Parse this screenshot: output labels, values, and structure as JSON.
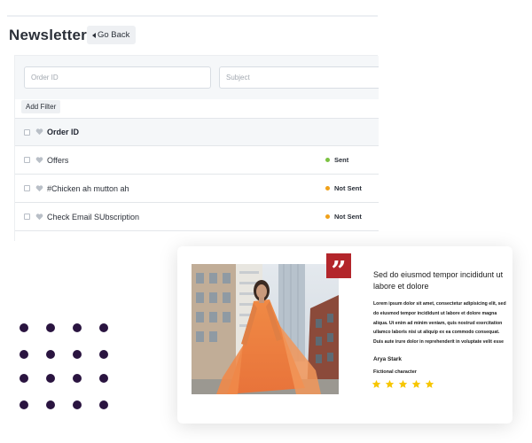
{
  "header": {
    "title": "Newsletter",
    "back_label": "Go Back"
  },
  "filters": {
    "order_id_placeholder": "Order ID",
    "subject_placeholder": "Subject",
    "add_filter_label": "Add Filter"
  },
  "table": {
    "column_header": "Order ID",
    "rows": [
      {
        "title": "Offers",
        "status": "Sent",
        "status_color": "#7cc242"
      },
      {
        "title": "#Chicken ah mutton ah",
        "status": "Not Sent",
        "status_color": "#f0a11a"
      },
      {
        "title": "Check Email SUbscription",
        "status": "Not Sent",
        "status_color": "#f0a11a"
      }
    ]
  },
  "testimonial": {
    "quote_icon": "quote-icon",
    "heading": "Sed do eiusmod tempor incididunt ut labore et dolore",
    "body": "Lorem ipsum dolor sit amet, consectetur adipisicing elit, sed do eiusmod tempor incididunt ut labore et dolore magna aliqua. Ut enim ad minim veniam, quis nostrud exercitation ullamco laboris nisi ut aliquip ex ea commodo consequat. Duis aute irure dolor in reprehenderit in voluptate velit esse",
    "author": "Arya Stark",
    "role": "Fictional character",
    "rating": 5,
    "accent_color": "#b3262b",
    "star_color": "#f7c600"
  },
  "decor": {
    "dot_color": "#2a1440"
  }
}
